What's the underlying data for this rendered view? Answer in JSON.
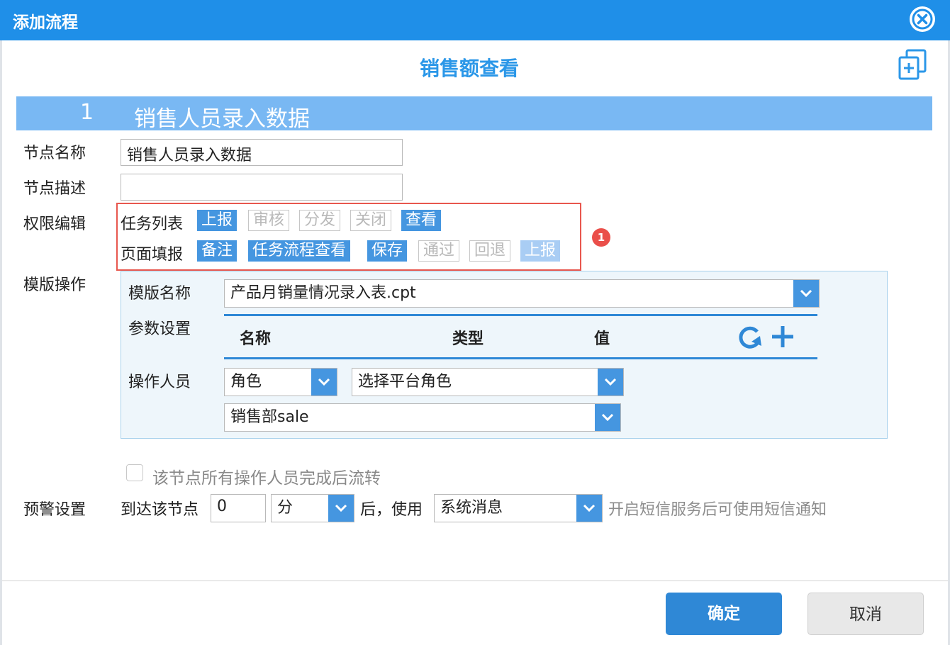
{
  "dialog": {
    "title": "添加流程"
  },
  "flow": {
    "title": "销售额查看"
  },
  "node": {
    "number": "1",
    "name": "销售人员录入数据"
  },
  "fields": {
    "node_name_label": "节点名称",
    "node_name_value": "销售人员录入数据",
    "node_desc_label": "节点描述",
    "node_desc_value": "",
    "perm_label": "权限编辑"
  },
  "permissions": {
    "task_list_label": "任务列表",
    "task_list_tags": [
      {
        "label": "上报",
        "state": "enabled"
      },
      {
        "label": "审核",
        "state": "disabled"
      },
      {
        "label": "分发",
        "state": "disabled"
      },
      {
        "label": "关闭",
        "state": "disabled"
      },
      {
        "label": "查看",
        "state": "enabled"
      }
    ],
    "page_fill_label": "页面填报",
    "page_fill_tags": [
      {
        "label": "备注",
        "state": "enabled"
      },
      {
        "label": "任务流程查看",
        "state": "enabled"
      },
      {
        "label": "保存",
        "state": "enabled"
      },
      {
        "label": "通过",
        "state": "disabled"
      },
      {
        "label": "回退",
        "state": "disabled"
      },
      {
        "label": "上报",
        "state": "enabled-faded"
      }
    ],
    "badge": "1"
  },
  "template": {
    "section_label": "模版操作",
    "name_label": "模版名称",
    "name_value": "产品月销量情况录入表.cpt",
    "params_label": "参数设置",
    "param_columns": [
      "名称",
      "类型",
      "值"
    ],
    "operator_label": "操作人员",
    "operator_type": "角色",
    "operator_platform": "选择平台角色",
    "operator_role": "销售部sale"
  },
  "flow_option": {
    "checkbox_label": "该节点所有操作人员完成后流转",
    "checked": false
  },
  "warning": {
    "label": "预警设置",
    "prefix": "到达该节点",
    "amount": "0",
    "unit": "分",
    "middle": "后，使用",
    "method": "系统消息",
    "hint": "开启短信服务后可使用短信通知"
  },
  "buttons": {
    "ok": "确定",
    "cancel": "取消"
  },
  "colors": {
    "title_bar": "#1f8fe8",
    "accent": "#4596e0",
    "node_bar": "#79b8f3",
    "highlight": "#e8574e"
  },
  "icons": {
    "close": "close-circle-icon",
    "copy": "copy-add-icon",
    "refresh": "refresh-icon",
    "add": "plus-icon",
    "dropdown": "chevron-down-icon"
  }
}
